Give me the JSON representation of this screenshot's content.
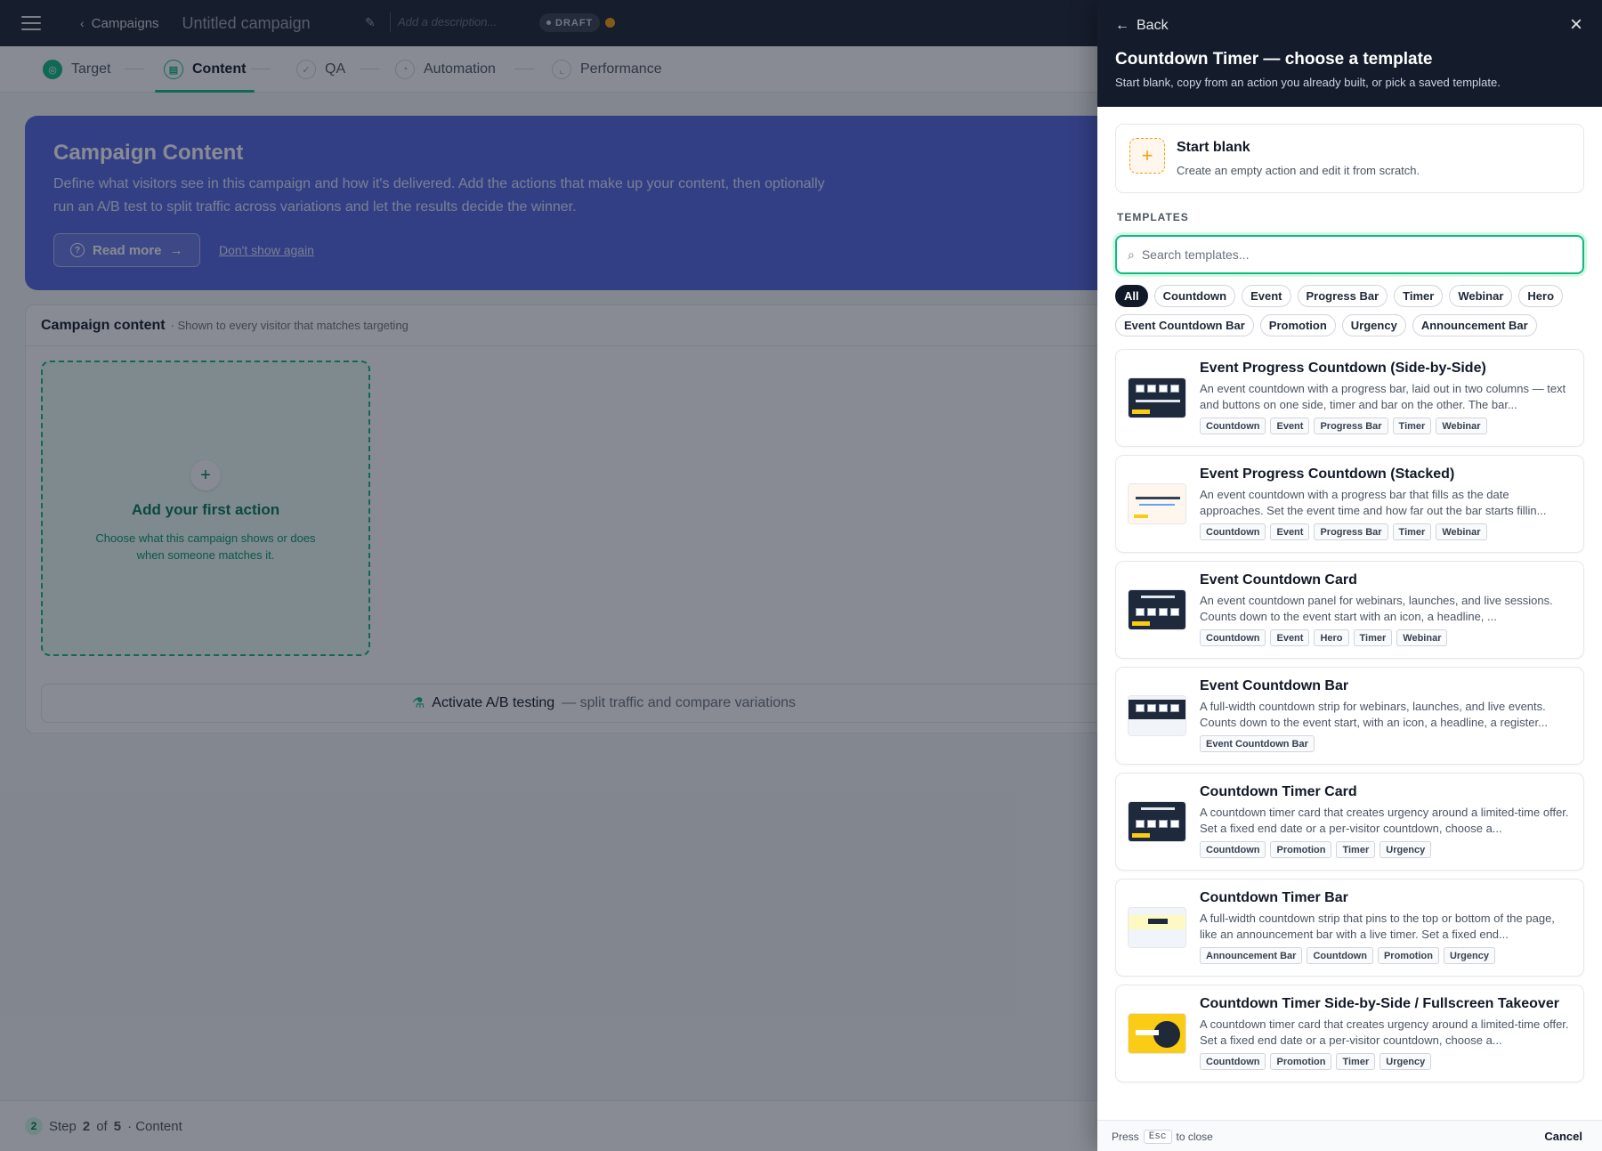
{
  "topbar": {
    "breadcrumb": "Campaigns",
    "campaign_title": "Untitled campaign",
    "description_placeholder": "Add a description...",
    "status_badge": "DRAFT"
  },
  "steps": [
    {
      "label": "Target",
      "state": "done"
    },
    {
      "label": "Content",
      "state": "active"
    },
    {
      "label": "QA",
      "state": "pending"
    },
    {
      "label": "Automation",
      "state": "pending"
    },
    {
      "label": "Performance",
      "state": "pending"
    }
  ],
  "hero": {
    "title": "Campaign Content",
    "text": "Define what visitors see in this campaign and how it's delivered. Add the actions that make up your content, then optionally run an A/B test to split traffic across variations and let the results decide the winner.",
    "read_more": "Read more",
    "dont_show": "Don't show again"
  },
  "content": {
    "title": "Campaign content",
    "subtitle": "· Shown to every visitor that matches targeting",
    "add_title": "Add your first action",
    "add_sub": "Choose what this campaign shows or does when someone matches it.",
    "ab_label": "Activate A/B testing",
    "ab_sub": "— split traffic and compare variations"
  },
  "footer": {
    "step_num": "2",
    "step_prefix": "Step",
    "step_current": "2",
    "step_of": "of",
    "step_total": "5",
    "step_name": "· Content"
  },
  "drawer": {
    "back": "Back",
    "title": "Countdown Timer — choose a template",
    "subtitle": "Start blank, copy from an action you already built, or pick a saved template.",
    "start_blank_title": "Start blank",
    "start_blank_sub": "Create an empty action and edit it from scratch.",
    "templates_label": "TEMPLATES",
    "search_placeholder": "Search templates...",
    "filters": [
      "All",
      "Countdown",
      "Event",
      "Progress Bar",
      "Timer",
      "Webinar",
      "Hero",
      "Event Countdown Bar",
      "Promotion",
      "Urgency",
      "Announcement Bar"
    ],
    "active_filter": "All",
    "templates": [
      {
        "title": "Event Progress Countdown (Side-by-Side)",
        "desc": "An event countdown with a progress bar, laid out in two columns — text and buttons on one side, timer and bar on the other. The bar...",
        "tags": [
          "Countdown",
          "Event",
          "Progress Bar",
          "Timer",
          "Webinar"
        ],
        "thumb": "dark-split"
      },
      {
        "title": "Event Progress Countdown (Stacked)",
        "desc": "An event countdown with a progress bar that fills as the date approaches. Set the event time and how far out the bar starts fillin...",
        "tags": [
          "Countdown",
          "Event",
          "Progress Bar",
          "Timer",
          "Webinar"
        ],
        "thumb": "light-stacked"
      },
      {
        "title": "Event Countdown Card",
        "desc": "An event countdown panel for webinars, launches, and live sessions. Counts down to the event start with an icon, a headline, ...",
        "tags": [
          "Countdown",
          "Event",
          "Hero",
          "Timer",
          "Webinar"
        ],
        "thumb": "dark-card"
      },
      {
        "title": "Event Countdown Bar",
        "desc": "A full-width countdown strip for webinars, launches, and live events. Counts down to the event start, with an icon, a headline, a register...",
        "tags": [
          "Event Countdown Bar"
        ],
        "thumb": "dark-bar"
      },
      {
        "title": "Countdown Timer Card",
        "desc": "A countdown timer card that creates urgency around a limited-time offer. Set a fixed end date or a per-visitor countdown, choose a...",
        "tags": [
          "Countdown",
          "Promotion",
          "Timer",
          "Urgency"
        ],
        "thumb": "dark-card"
      },
      {
        "title": "Countdown Timer Bar",
        "desc": "A full-width countdown strip that pins to the top or bottom of the page, like an announcement bar with a live timer. Set a fixed end...",
        "tags": [
          "Announcement Bar",
          "Countdown",
          "Promotion",
          "Urgency"
        ],
        "thumb": "light-bar"
      },
      {
        "title": "Countdown Timer Side-by-Side / Fullscreen Takeover",
        "desc": "A countdown timer card that creates urgency around a limited-time offer. Set a fixed end date or a per-visitor countdown, choose a...",
        "tags": [
          "Countdown",
          "Promotion",
          "Timer",
          "Urgency"
        ],
        "thumb": "yellow-takeover"
      }
    ],
    "esc_prefix": "Press",
    "esc_key": "Esc",
    "esc_suffix": "to close",
    "cancel": "Cancel"
  },
  "colors": {
    "accent": "#10b981",
    "hero": "#5567e3",
    "drawer_header": "#141c2b",
    "topbar": "#1a2332",
    "draft_dot": "#f59e0b"
  }
}
